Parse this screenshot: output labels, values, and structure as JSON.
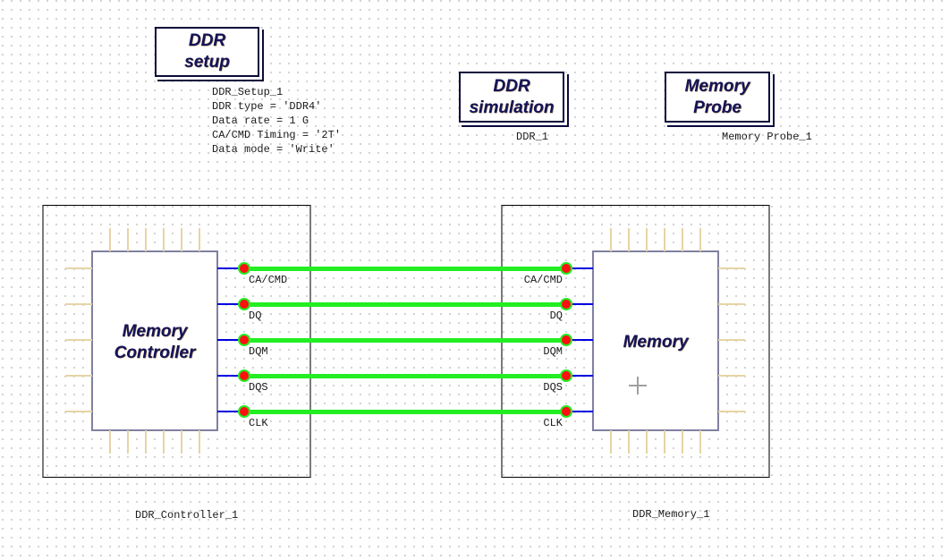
{
  "components": {
    "ddr_setup": {
      "title_lines": [
        "DDR",
        "setup"
      ],
      "instance_name": "DDR_Setup_1",
      "params": [
        "DDR type = 'DDR4'",
        "Data rate = 1 G",
        "CA/CMD Timing = '2T'",
        "Data mode = 'Write'"
      ]
    },
    "ddr_simulation": {
      "title_lines": [
        "DDR",
        "simulation"
      ],
      "instance_name": "DDR_1"
    },
    "memory_probe": {
      "title_lines": [
        "Memory",
        "Probe"
      ],
      "instance_name": "Memory Probe_1"
    },
    "controller": {
      "title_lines": [
        "Memory",
        "Controller"
      ],
      "instance_name": "DDR_Controller_1"
    },
    "memory": {
      "title_lines": [
        "Memory"
      ],
      "instance_name": "DDR_Memory_1"
    }
  },
  "ports": [
    "CA/CMD",
    "DQ",
    "DQM",
    "DQS",
    "CLK"
  ],
  "colors": {
    "wire": "#22ee22",
    "node": "#ff1010",
    "stub": "#0000e0",
    "pin": "#e6d4a4",
    "component_text": "#14145a"
  }
}
